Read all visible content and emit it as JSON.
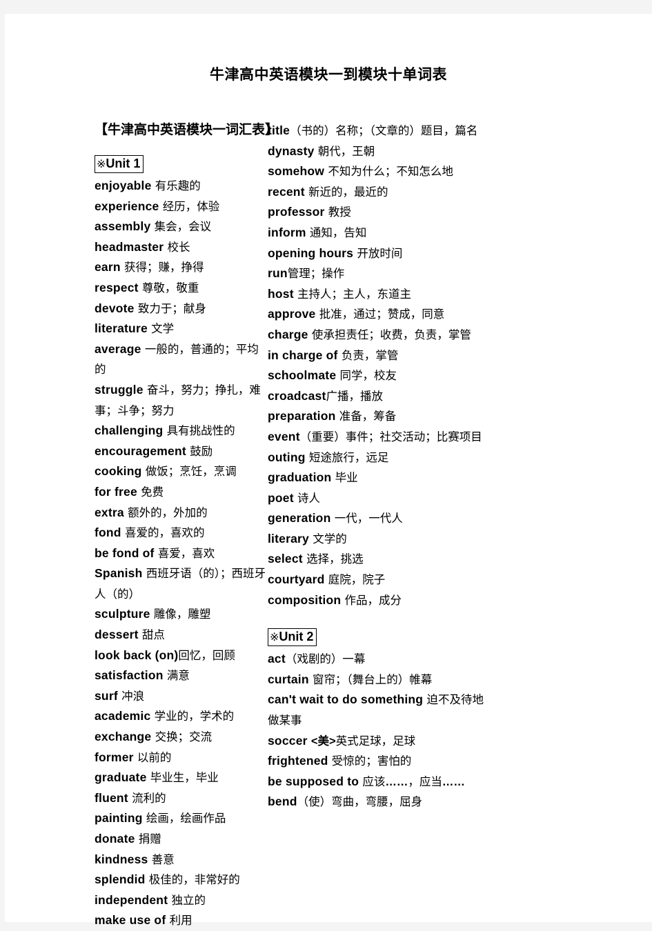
{
  "document": {
    "title": "牛津高中英语模块一到模块十单词表",
    "section_heading": "【牛津高中英语模块一词汇表】"
  },
  "units": {
    "unit1": {
      "mark": "※",
      "label": "Unit 1"
    },
    "unit2": {
      "mark": "※",
      "label": "Unit 2"
    }
  },
  "left_column": [
    {
      "en": "enjoyable",
      "cn": " 有乐趣的"
    },
    {
      "en": "experience",
      "cn": " 经历，体验"
    },
    {
      "en": "assembly",
      "cn": " 集会，会议"
    },
    {
      "en": "headmaster",
      "cn": " 校长"
    },
    {
      "en": "earn",
      "cn": " 获得；赚，挣得"
    },
    {
      "en": "respect",
      "cn": " 尊敬，敬重"
    },
    {
      "en": "devote",
      "cn": " 致力于；献身"
    },
    {
      "en": "literature",
      "cn": " 文学"
    },
    {
      "en": "average",
      "cn": " 一般的，普通的；平均的"
    },
    {
      "en": "struggle",
      "cn": " 奋斗，努力；挣扎，难事；斗争；努力"
    },
    {
      "en": "challenging",
      "cn": " 具有挑战性的"
    },
    {
      "en": "encouragement",
      "cn": " 鼓励"
    },
    {
      "en": "cooking",
      "cn": " 做饭；烹饪，烹调"
    },
    {
      "en": "for free",
      "cn": " 免费"
    },
    {
      "en": "extra",
      "cn": " 额外的，外加的"
    },
    {
      "en": "fond",
      "cn": " 喜爱的，喜欢的"
    },
    {
      "en": "be fond of",
      "cn": " 喜爱，喜欢"
    },
    {
      "en": "Spanish",
      "cn": " 西班牙语（的）；西班牙人（的）"
    },
    {
      "en": "sculpture",
      "cn": " 雕像，雕塑"
    },
    {
      "en": "dessert",
      "cn": " 甜点"
    },
    {
      "en": "look back (on)",
      "cn": "回忆，回顾"
    },
    {
      "en": "satisfaction",
      "cn": "  满意"
    },
    {
      "en": "surf",
      "cn": " 冲浪"
    },
    {
      "en": "academic",
      "cn": " 学业的，学术的"
    },
    {
      "en": "exchange",
      "cn": " 交换；交流"
    },
    {
      "en": "former",
      "cn": " 以前的"
    },
    {
      "en": "graduate",
      "cn": " 毕业生，毕业"
    },
    {
      "en": "fluent",
      "cn": " 流利的"
    },
    {
      "en": "painting",
      "cn": " 绘画，绘画作品"
    },
    {
      "en": "donate",
      "cn": " 捐赠"
    },
    {
      "en": "kindness",
      "cn": " 善意"
    },
    {
      "en": "splendid",
      "cn": " 极佳的，非常好的"
    },
    {
      "en": "independent",
      "cn": " 独立的"
    },
    {
      "en": "make use of",
      "cn": " 利用"
    }
  ],
  "right_column_unit1": [
    {
      "en": "title",
      "cn": "（书的）名称；（文章的）题目，篇名"
    },
    {
      "en": "dynasty",
      "cn": " 朝代，王朝"
    },
    {
      "en": "somehow",
      "cn": " 不知为什么；不知怎么地"
    },
    {
      "en": "recent",
      "cn": " 新近的，最近的"
    },
    {
      "en": "professor",
      "cn": " 教授"
    },
    {
      "en": "inform",
      "cn": " 通知，告知"
    },
    {
      "en": "opening hours",
      "cn": " 开放时间"
    },
    {
      "en": "run",
      "cn": "管理；操作"
    },
    {
      "en": "host",
      "cn": " 主持人；主人，东道主"
    },
    {
      "en": "approve",
      "cn": " 批准，通过；赞成，同意"
    },
    {
      "en": "charge",
      "cn": " 使承担责任；收费，负责，掌管"
    },
    {
      "en": "in charge of",
      "cn": " 负责，掌管"
    },
    {
      "en": "schoolmate",
      "cn": " 同学，校友"
    },
    {
      "en": "croadcast",
      "cn": "广播，播放"
    },
    {
      "en": "preparation",
      "cn": " 准备，筹备"
    },
    {
      "en": "event",
      "cn": "（重要）事件；社交活动；比赛项目"
    },
    {
      "en": "outing",
      "cn": " 短途旅行，远足"
    },
    {
      "en": "graduation",
      "cn": " 毕业"
    },
    {
      "en": "poet",
      "cn": " 诗人"
    },
    {
      "en": "generation",
      "cn": " 一代，一代人"
    },
    {
      "en": "literary",
      "cn": " 文学的"
    },
    {
      "en": "select",
      "cn": " 选择，挑选"
    },
    {
      "en": "courtyard",
      "cn": " 庭院，院子"
    },
    {
      "en": "composition",
      "cn": " 作品，成分"
    }
  ],
  "right_column_unit2": [
    {
      "en": "act",
      "cn": "（戏剧的）一幕"
    },
    {
      "en": "curtain",
      "cn": " 窗帘；（舞台上的）帷幕"
    },
    {
      "en": "can't wait to do something",
      "cn": " 迫不及待地做某事"
    },
    {
      "en": "soccer",
      "cn": "  <b>&lt;美&gt;</b>英式足球，足球"
    },
    {
      "en": "frightened",
      "cn": " 受惊的；害怕的"
    },
    {
      "en": "be supposed to",
      "cn": " 应该<b>……</b>，应当<b>……</b>"
    },
    {
      "en": "bend",
      "cn": "（使）弯曲，弯腰，屈身"
    }
  ]
}
